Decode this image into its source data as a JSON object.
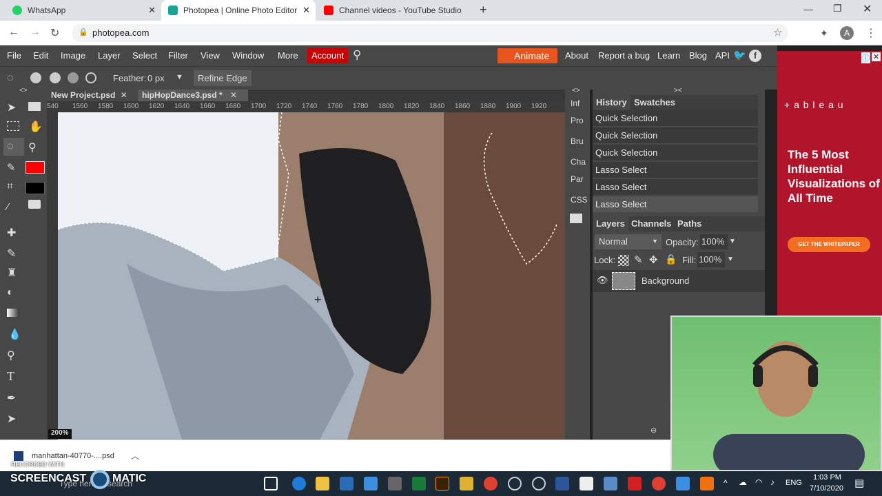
{
  "browser": {
    "tabs": [
      {
        "label": "WhatsApp",
        "color": "#25d366"
      },
      {
        "label": "Photopea | Online Photo Editor",
        "color": "#18a497"
      },
      {
        "label": "Channel videos - YouTube Studio",
        "color": "#ff0000"
      }
    ],
    "new_tab": "+",
    "url": "photopea.com",
    "profile": "A"
  },
  "menu": {
    "items": [
      "File",
      "Edit",
      "Image",
      "Layer",
      "Select",
      "Filter",
      "View",
      "Window",
      "More"
    ],
    "account": "Account",
    "animate": "Animate",
    "links": [
      "About",
      "Report a bug",
      "Learn",
      "Blog",
      "API"
    ]
  },
  "options": {
    "feather_label": "Feather:",
    "feather_value": "0 px",
    "refine_edge": "Refine Edge"
  },
  "documents": {
    "tabs": [
      "New Project.psd",
      "hipHopDance3.psd *"
    ],
    "ruler_ticks": [
      "540",
      "1560",
      "1580",
      "1600",
      "1620",
      "1640",
      "1660",
      "1680",
      "1700",
      "1720",
      "1740",
      "1760",
      "1780",
      "1800",
      "1820",
      "1840",
      "1860",
      "1880",
      "1900",
      "1920"
    ],
    "zoom": "200%"
  },
  "sidetabs": [
    "Inf",
    "Pro",
    "Bru",
    "Cha",
    "Par",
    "CSS"
  ],
  "history": {
    "tabs": [
      "History",
      "Swatches"
    ],
    "items": [
      "Quick Selection",
      "Quick Selection",
      "Quick Selection",
      "Lasso Select",
      "Lasso Select",
      "Lasso Select"
    ]
  },
  "layers": {
    "tabs": [
      "Layers",
      "Channels",
      "Paths"
    ],
    "blend_mode": "Normal",
    "opacity_label": "Opacity:",
    "opacity_value": "100%",
    "lock_label": "Lock:",
    "fill_label": "Fill:",
    "fill_value": "100%",
    "layer_name": "Background"
  },
  "ad": {
    "brand": "+ a b l e a u",
    "headline": "The 5 Most Influential Visualizations of All Time",
    "cta": "GET THE WHITEPAPER"
  },
  "download": {
    "file": "manhattan-40770-....psd"
  },
  "watermark": {
    "line1": "RECORDED WITH",
    "line2": "SCREENCAST",
    "line3": "MATIC"
  },
  "taskbar": {
    "search": "Type here to search",
    "lang": "ENG",
    "time": "1:03 PM",
    "date": "7/10/2020"
  },
  "colors": {
    "foreground": "#ff0000",
    "background": "#000000",
    "account_btn": "#cc0000",
    "animate_btn": "#e8541e"
  }
}
